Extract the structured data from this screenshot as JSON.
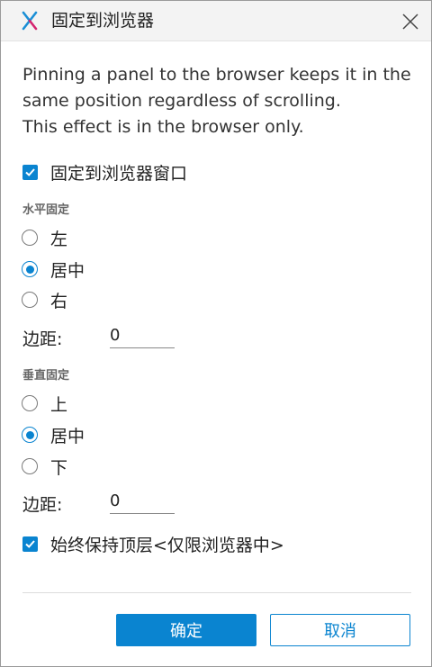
{
  "dialog": {
    "title": "固定到浏览器",
    "description": [
      "Pinning a panel to the browser keeps it in the",
      "same position regardless of scrolling.",
      "This effect is in the browser only."
    ],
    "pin_checkbox": {
      "label": "固定到浏览器窗口",
      "checked": true
    },
    "horizontal": {
      "title": "水平固定",
      "options": [
        {
          "label": "左",
          "checked": false
        },
        {
          "label": "居中",
          "checked": true
        },
        {
          "label": "右",
          "checked": false
        }
      ],
      "margin_label": "边距:",
      "margin_value": "0"
    },
    "vertical": {
      "title": "垂直固定",
      "options": [
        {
          "label": "上",
          "checked": false
        },
        {
          "label": "居中",
          "checked": true
        },
        {
          "label": "下",
          "checked": false
        }
      ],
      "margin_label": "边距:",
      "margin_value": "0"
    },
    "topmost_checkbox": {
      "label": "始终保持顶层<仅限浏览器中>",
      "checked": true
    },
    "ok_label": "确定",
    "cancel_label": "取消"
  },
  "colors": {
    "accent": "#0a84d0",
    "app_icon_primary": "#1a8fd6",
    "app_icon_secondary": "#d4236f"
  },
  "icons": {
    "app": "axure-x-icon",
    "close": "close-icon",
    "check": "checkmark-icon"
  }
}
